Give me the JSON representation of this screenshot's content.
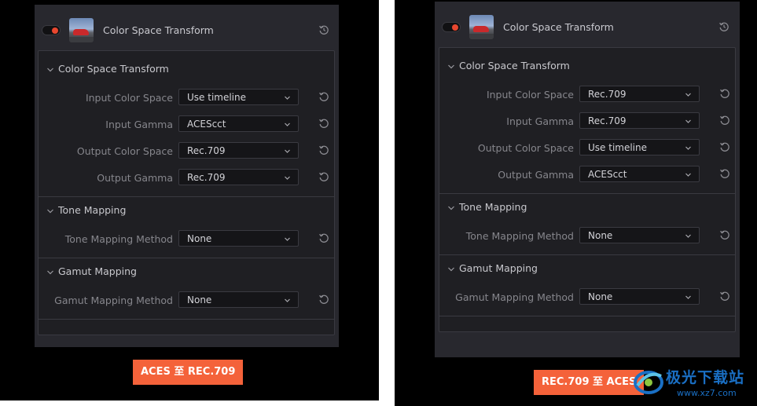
{
  "panels": [
    {
      "plugin_title": "Color Space Transform",
      "sections": [
        {
          "title": "Color Space Transform",
          "rows": [
            {
              "label": "Input Color Space",
              "value": "Use timeline"
            },
            {
              "label": "Input Gamma",
              "value": "ACEScct"
            },
            {
              "label": "Output Color Space",
              "value": "Rec.709"
            },
            {
              "label": "Output Gamma",
              "value": "Rec.709"
            }
          ]
        },
        {
          "title": "Tone Mapping",
          "rows": [
            {
              "label": "Tone Mapping Method",
              "value": "None"
            }
          ]
        },
        {
          "title": "Gamut Mapping",
          "rows": [
            {
              "label": "Gamut Mapping Method",
              "value": "None"
            }
          ]
        }
      ],
      "caption": "ACES 至 REC.709"
    },
    {
      "plugin_title": "Color Space Transform",
      "sections": [
        {
          "title": "Color Space Transform",
          "rows": [
            {
              "label": "Input Color Space",
              "value": "Rec.709"
            },
            {
              "label": "Input Gamma",
              "value": "Rec.709"
            },
            {
              "label": "Output Color Space",
              "value": "Use timeline"
            },
            {
              "label": "Output Gamma",
              "value": "ACEScct"
            }
          ]
        },
        {
          "title": "Tone Mapping",
          "rows": [
            {
              "label": "Tone Mapping Method",
              "value": "None"
            }
          ]
        },
        {
          "title": "Gamut Mapping",
          "rows": [
            {
              "label": "Gamut Mapping Method",
              "value": "None"
            }
          ]
        }
      ],
      "caption": "REC.709 至 ACES"
    }
  ],
  "watermark": {
    "title": "极光下载站",
    "url": "www.xz7.com"
  },
  "colors": {
    "panel_background": "#28282e",
    "inner_background": "#1f1f23",
    "toggle_on": "#e8472f",
    "caption_background": "#f4623a",
    "watermark_blue": "#1a6fc4"
  },
  "icons": {
    "toggle": "enable-toggle",
    "thumbnail": "plugin-thumbnail",
    "reset": "reset-icon",
    "section_chevron": "chevron-down-icon",
    "dropdown_arrow": "chevron-down-icon"
  }
}
